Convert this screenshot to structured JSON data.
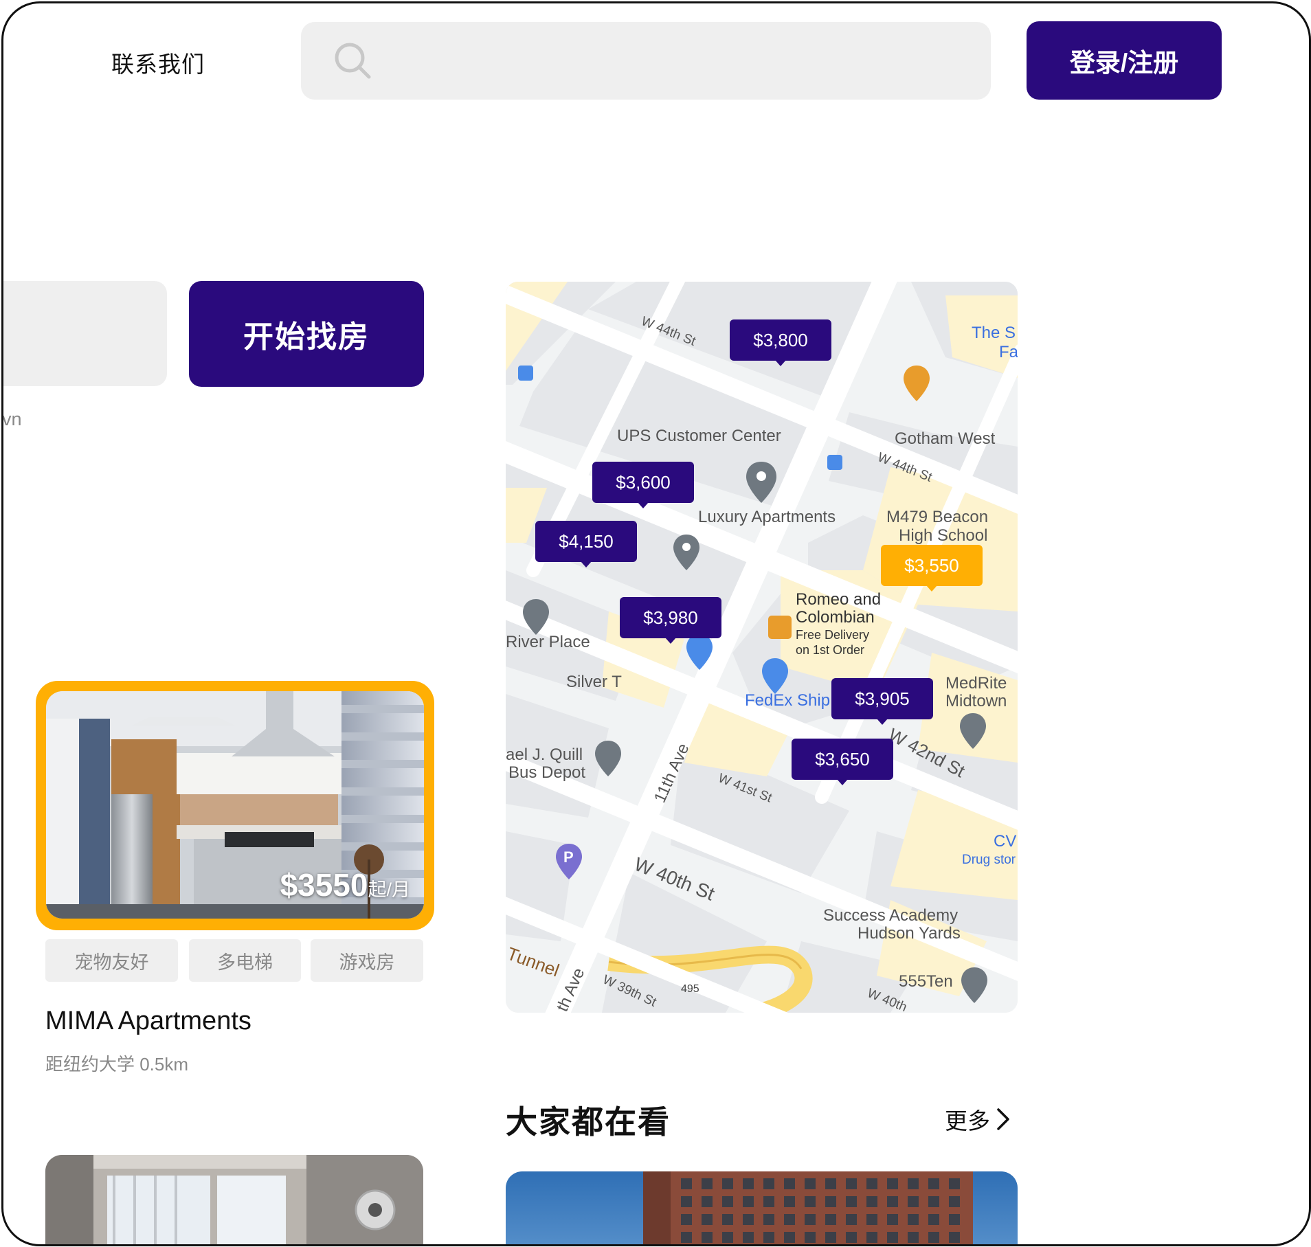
{
  "header": {
    "contact_label": "联系我们",
    "search_placeholder": "",
    "login_label": "登录/注册"
  },
  "hero": {
    "start_button_label": "开始找房",
    "location_fragment": "vn"
  },
  "listing": {
    "price": "$3550",
    "price_unit": "起/月",
    "tags": [
      "宠物友好",
      "多电梯",
      "游戏房"
    ],
    "name": "MIMA Apartments",
    "distance": "距纽约大学 0.5km"
  },
  "map": {
    "price_pins": [
      "$3,800",
      "$3,600",
      "$4,150",
      "$3,980",
      "$3,550",
      "$3,905",
      "$3,650"
    ],
    "highlighted_pin": "$3,550",
    "streets": [
      "W 44th St",
      "W 44th St",
      "11th Ave",
      "W 41st St",
      "W 40th St",
      "W 42nd St",
      "W 39th St",
      "W 40th",
      "Tunnel",
      "th Ave",
      "495"
    ],
    "places": [
      "The S",
      "Fa",
      "Gotham West",
      "UPS Customer Center",
      "Luxury Apartments",
      "M479 Beacon",
      "High School",
      "River Place",
      "Silver T",
      "Romeo and",
      "Colombian",
      "Free Delivery",
      "on 1st Order",
      "FedEx Ship Center",
      "MedRite",
      "Midtown",
      "ael J. Quill",
      "Bus Depot",
      "CV",
      "Drug stor",
      "Success Academy",
      "Hudson Yards",
      "555Ten"
    ],
    "colors": {
      "pin": "#2a0a7d",
      "pin_highlight": "#ffaf04",
      "road": "#ffffff",
      "block": "#e5e7ea",
      "commercial": "#fdf3cf",
      "highway": "#f9d86e"
    }
  },
  "popular": {
    "title": "大家都在看",
    "more_label": "更多"
  },
  "theme": {
    "accent": "#2a0a7d",
    "highlight": "#ffaf04",
    "muted_bg": "#efefef"
  }
}
